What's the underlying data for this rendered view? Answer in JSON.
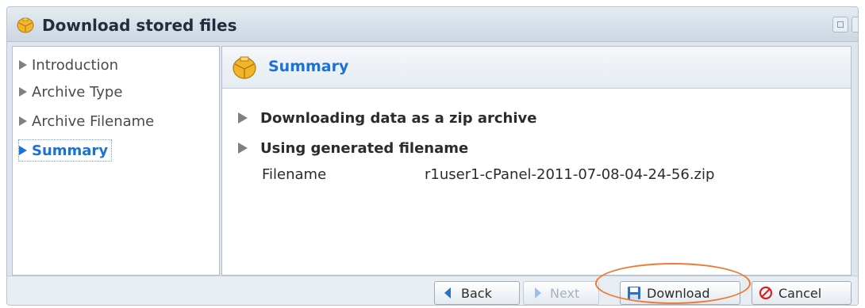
{
  "window": {
    "title": "Download stored files",
    "icon": "package-icon"
  },
  "sidebar": {
    "items": [
      {
        "label": "Introduction",
        "active": false
      },
      {
        "label": "Archive Type",
        "active": false
      },
      {
        "label": "Archive Filename",
        "active": false
      },
      {
        "label": "Summary",
        "active": true
      }
    ]
  },
  "summary": {
    "title": "Summary",
    "bullets": [
      "Downloading data as a zip archive",
      "Using generated filename"
    ],
    "filename_label": "Filename",
    "filename_value": "r1user1-cPanel-2011-07-08-04-24-56.zip"
  },
  "footer": {
    "back_label": "Back",
    "next_label": "Next",
    "download_label": "Download",
    "cancel_label": "Cancel"
  },
  "colors": {
    "accent": "#1a72d4",
    "highlight": "#f07a33",
    "window_bg": "#dde5ee"
  }
}
